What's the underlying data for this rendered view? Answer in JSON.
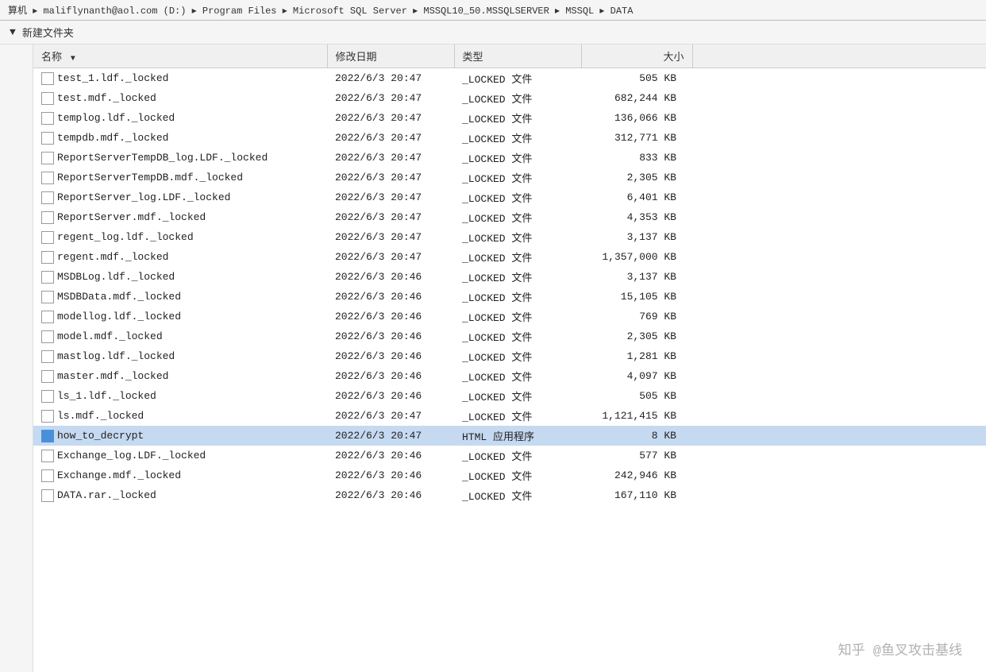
{
  "addressBar": {
    "text": "算机 ▸ maliflynanth@aol.com (D:) ▸ Program Files ▸ Microsoft SQL Server ▸ MSSQL10_50.MSSQLSERVER ▸ MSSQL ▸ DATA"
  },
  "toolbar": {
    "newFolderLabel": "新建文件夹",
    "arrowLabel": "▼"
  },
  "table": {
    "columns": [
      "名称",
      "修改日期",
      "类型",
      "大小"
    ],
    "sortIndicator": "▼",
    "files": [
      {
        "name": "test_1.ldf._locked",
        "date": "2022/6/3 20:47",
        "type": "_LOCKED 文件",
        "size": "505 KB",
        "icon": "doc",
        "highlight": false
      },
      {
        "name": "test.mdf._locked",
        "date": "2022/6/3 20:47",
        "type": "_LOCKED 文件",
        "size": "682,244 KB",
        "icon": "doc",
        "highlight": false
      },
      {
        "name": "templog.ldf._locked",
        "date": "2022/6/3 20:47",
        "type": "_LOCKED 文件",
        "size": "136,066 KB",
        "icon": "doc",
        "highlight": false
      },
      {
        "name": "tempdb.mdf._locked",
        "date": "2022/6/3 20:47",
        "type": "_LOCKED 文件",
        "size": "312,771 KB",
        "icon": "doc",
        "highlight": false
      },
      {
        "name": "ReportServerTempDB_log.LDF._locked",
        "date": "2022/6/3 20:47",
        "type": "_LOCKED 文件",
        "size": "833 KB",
        "icon": "doc",
        "highlight": false
      },
      {
        "name": "ReportServerTempDB.mdf._locked",
        "date": "2022/6/3 20:47",
        "type": "_LOCKED 文件",
        "size": "2,305 KB",
        "icon": "doc",
        "highlight": false
      },
      {
        "name": "ReportServer_log.LDF._locked",
        "date": "2022/6/3 20:47",
        "type": "_LOCKED 文件",
        "size": "6,401 KB",
        "icon": "doc",
        "highlight": false
      },
      {
        "name": "ReportServer.mdf._locked",
        "date": "2022/6/3 20:47",
        "type": "_LOCKED 文件",
        "size": "4,353 KB",
        "icon": "doc",
        "highlight": false
      },
      {
        "name": "regent_log.ldf._locked",
        "date": "2022/6/3 20:47",
        "type": "_LOCKED 文件",
        "size": "3,137 KB",
        "icon": "doc",
        "highlight": false
      },
      {
        "name": "regent.mdf._locked",
        "date": "2022/6/3 20:47",
        "type": "_LOCKED 文件",
        "size": "1,357,000 KB",
        "icon": "doc",
        "highlight": false
      },
      {
        "name": "MSDBLog.ldf._locked",
        "date": "2022/6/3 20:46",
        "type": "_LOCKED 文件",
        "size": "3,137 KB",
        "icon": "doc",
        "highlight": false
      },
      {
        "name": "MSDBData.mdf._locked",
        "date": "2022/6/3 20:46",
        "type": "_LOCKED 文件",
        "size": "15,105 KB",
        "icon": "doc",
        "highlight": false
      },
      {
        "name": "modellog.ldf._locked",
        "date": "2022/6/3 20:46",
        "type": "_LOCKED 文件",
        "size": "769 KB",
        "icon": "doc",
        "highlight": false
      },
      {
        "name": "model.mdf._locked",
        "date": "2022/6/3 20:46",
        "type": "_LOCKED 文件",
        "size": "2,305 KB",
        "icon": "doc",
        "highlight": false
      },
      {
        "name": "mastlog.ldf._locked",
        "date": "2022/6/3 20:46",
        "type": "_LOCKED 文件",
        "size": "1,281 KB",
        "icon": "doc",
        "highlight": false
      },
      {
        "name": "master.mdf._locked",
        "date": "2022/6/3 20:46",
        "type": "_LOCKED 文件",
        "size": "4,097 KB",
        "icon": "doc",
        "highlight": false
      },
      {
        "name": "ls_1.ldf._locked",
        "date": "2022/6/3 20:46",
        "type": "_LOCKED 文件",
        "size": "505 KB",
        "icon": "doc",
        "highlight": false
      },
      {
        "name": "ls.mdf._locked",
        "date": "2022/6/3 20:47",
        "type": "_LOCKED 文件",
        "size": "1,121,415 KB",
        "icon": "doc",
        "highlight": false
      },
      {
        "name": "how_to_decrypt",
        "date": "2022/6/3 20:47",
        "type": "HTML 应用程序",
        "size": "8 KB",
        "icon": "html",
        "highlight": true
      },
      {
        "name": "Exchange_log.LDF._locked",
        "date": "2022/6/3 20:46",
        "type": "_LOCKED 文件",
        "size": "577 KB",
        "icon": "doc",
        "highlight": false
      },
      {
        "name": "Exchange.mdf._locked",
        "date": "2022/6/3 20:46",
        "type": "_LOCKED 文件",
        "size": "242,946 KB",
        "icon": "doc",
        "highlight": false
      },
      {
        "name": "DATA.rar._locked",
        "date": "2022/6/3 20:46",
        "type": "_LOCKED 文件",
        "size": "167,110 KB",
        "icon": "doc",
        "highlight": false
      }
    ]
  },
  "watermark": {
    "text": "知乎 @鱼叉攻击基线"
  }
}
